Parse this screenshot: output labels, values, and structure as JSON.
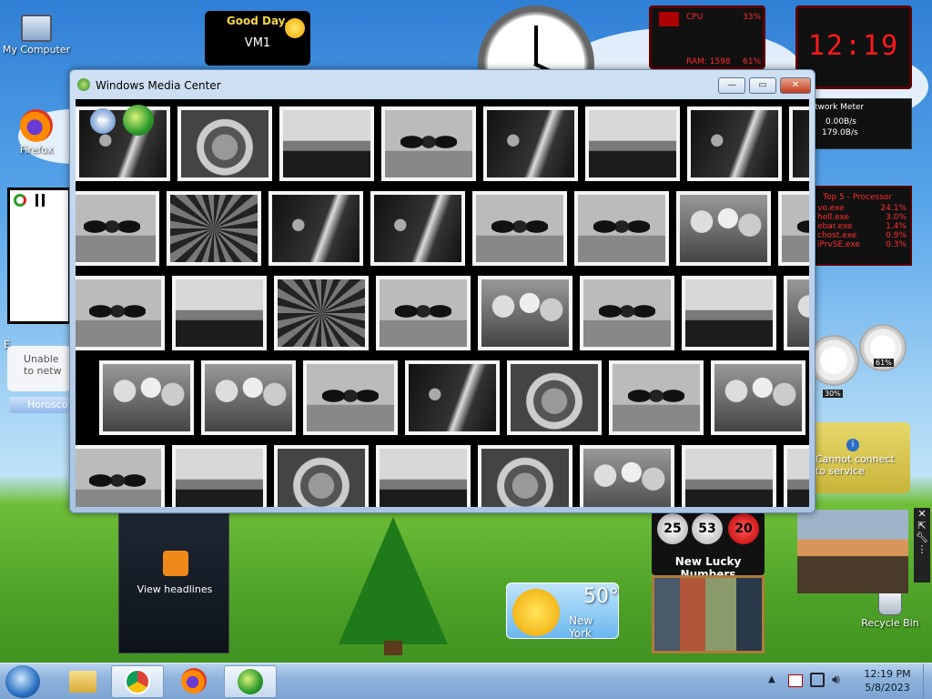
{
  "desktop": {
    "icons": [
      {
        "label": "My Computer",
        "icon": "computer-icon"
      },
      {
        "label": "Firefox",
        "icon": "firefox-icon"
      },
      {
        "label": "Recycle Bin",
        "icon": "recycle-bin-icon"
      }
    ]
  },
  "greeting_gadget": {
    "line1": "Good Day,",
    "line2": "VM1"
  },
  "cpu_gadget": {
    "cpu_label": "CPU",
    "cpu_value": "33%",
    "ram_label": "RAM: 1598",
    "ram_value": "61%"
  },
  "clock_digital": {
    "time": "12:19"
  },
  "network_meter": {
    "title": "twork Meter",
    "up": "0.00B/s",
    "down": "179.0B/s"
  },
  "top_processes": {
    "title": "Top 5 - Processor",
    "rows": [
      {
        "name": "vo.exe",
        "value": "24.1%"
      },
      {
        "name": "hell.exe",
        "value": "3.0%"
      },
      {
        "name": "ebar.exe",
        "value": "1.4%"
      },
      {
        "name": "chost.exe",
        "value": "0.9%"
      },
      {
        "name": "iPrvSE.exe",
        "value": "0.3%"
      }
    ]
  },
  "meters_gadget": {
    "cpu": "30%",
    "ram": "61%"
  },
  "currency_gadget": {
    "message": "Cannot connect to service"
  },
  "left_gadgets": {
    "unable_text": "Unable to netw",
    "horoscope_label": "Horosco",
    "partial_label": "E"
  },
  "feed_gadget": {
    "label": "View headlines"
  },
  "lucky_numbers": {
    "numbers": [
      "25",
      "53",
      "20"
    ],
    "label": "New Lucky Numbers"
  },
  "weather": {
    "temp": "50°",
    "city": "New York"
  },
  "window": {
    "title": "Windows Media Center",
    "rows": [
      [
        "jelly",
        "koala",
        "light",
        "peng",
        "jelly",
        "light",
        "jelly",
        "jelly"
      ],
      [
        "peng",
        "flower",
        "jelly",
        "jelly",
        "peng",
        "peng",
        "tulip",
        "peng"
      ],
      [
        "peng",
        "light",
        "flower",
        "peng",
        "tulip",
        "peng",
        "light",
        "tulip"
      ],
      [
        "tulip",
        "tulip",
        "peng",
        "jelly",
        "koala",
        "peng",
        "tulip"
      ],
      [
        "peng",
        "light",
        "koala",
        "light",
        "koala",
        "tulip",
        "light",
        "light"
      ]
    ]
  },
  "taskbar": {
    "apps": [
      "start-orb",
      "file-explorer",
      "chrome",
      "firefox",
      "media-center"
    ],
    "time": "12:19 PM",
    "date": "5/8/2023"
  }
}
